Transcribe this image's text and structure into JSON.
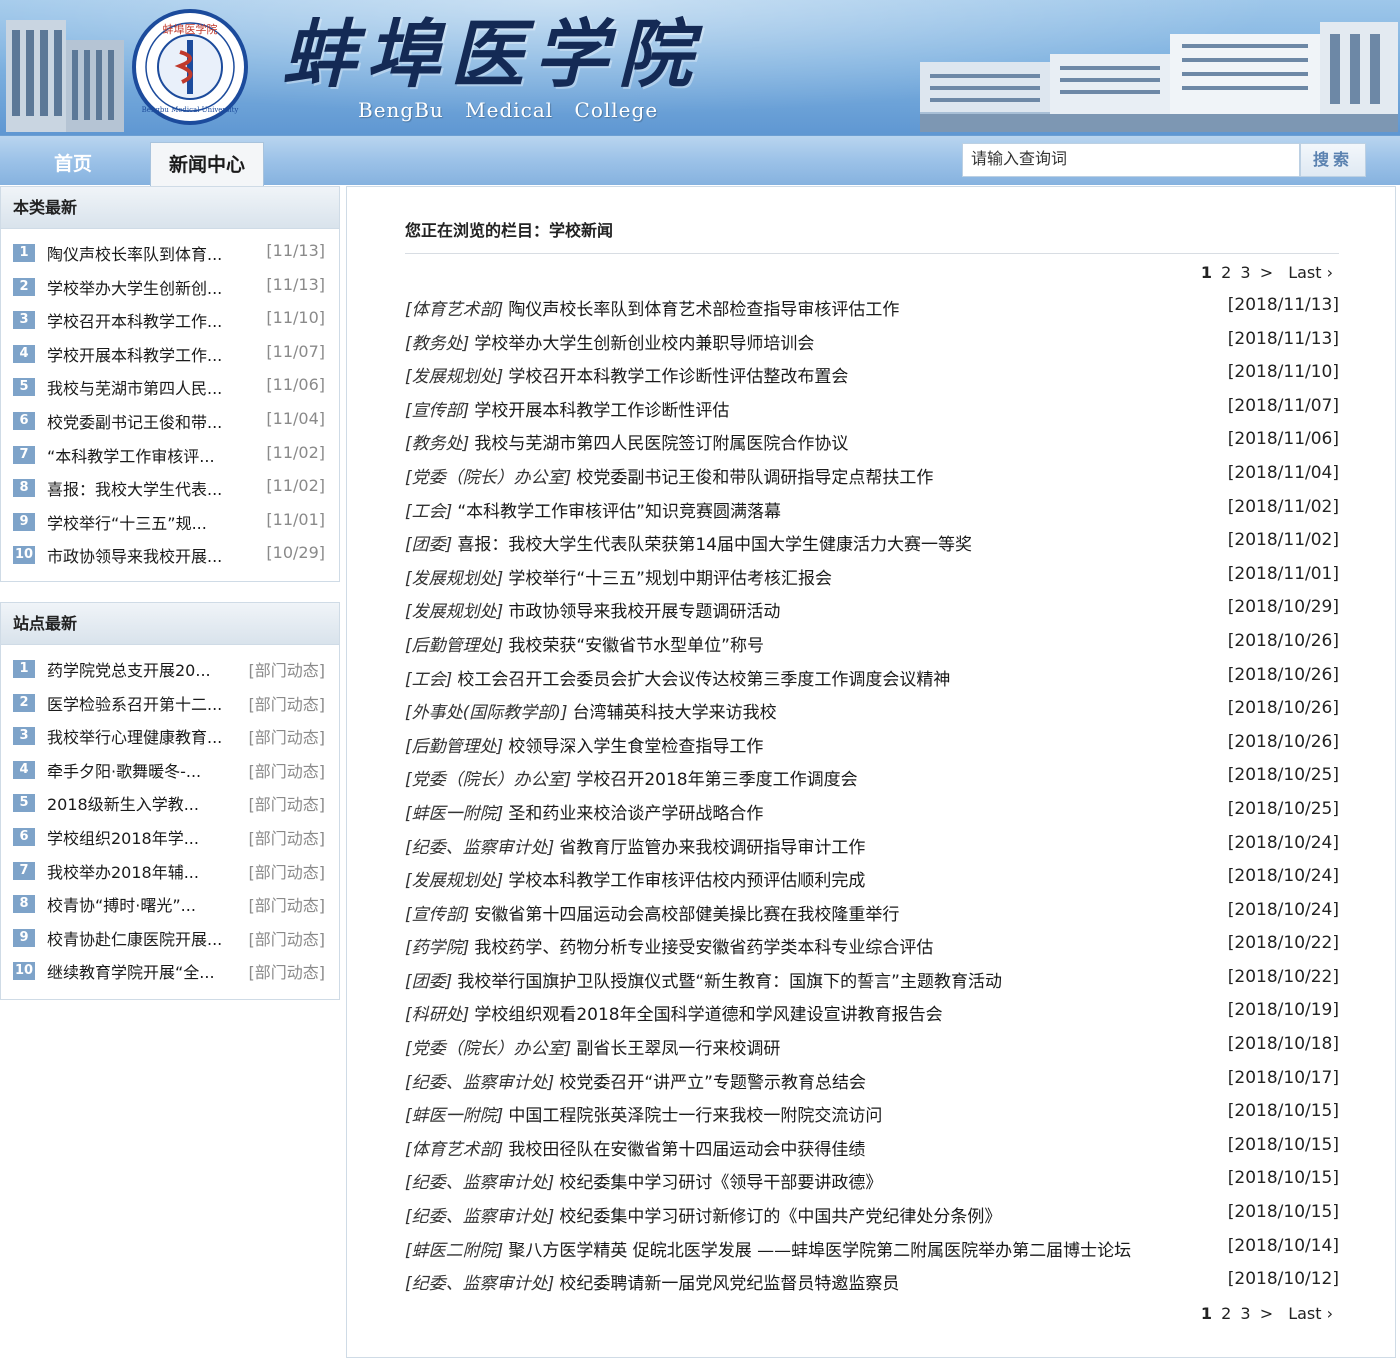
{
  "header": {
    "logo_cn": "蚌埠医学院",
    "logo_en": "BengBu Medical College",
    "emblem_text": "蚌埠医学院 Bengbu Medical University"
  },
  "nav": {
    "home": "首页",
    "news_center": "新闻中心",
    "search_placeholder": "请输入查询词",
    "search_button": "搜索"
  },
  "sidebar": {
    "recent_title": "本类最新",
    "recent": [
      {
        "num": "1",
        "title": "陶仪声校长率队到体育...",
        "date": "[11/13]"
      },
      {
        "num": "2",
        "title": "学校举办大学生创新创...",
        "date": "[11/13]"
      },
      {
        "num": "3",
        "title": "学校召开本科教学工作...",
        "date": "[11/10]"
      },
      {
        "num": "4",
        "title": "学校开展本科教学工作...",
        "date": "[11/07]"
      },
      {
        "num": "5",
        "title": "我校与芜湖市第四人民...",
        "date": "[11/06]"
      },
      {
        "num": "6",
        "title": "校党委副书记王俊和带...",
        "date": "[11/04]"
      },
      {
        "num": "7",
        "title": "“本科教学工作审核评...",
        "date": "[11/02]"
      },
      {
        "num": "8",
        "title": "喜报：我校大学生代表...",
        "date": "[11/02]"
      },
      {
        "num": "9",
        "title": "学校举行“十三五”规...",
        "date": "[11/01]"
      },
      {
        "num": "10",
        "title": "市政协领导来我校开展...",
        "date": "[10/29]"
      }
    ],
    "site_title": "站点最新",
    "site": [
      {
        "num": "1",
        "title": "药学院党总支开展20...",
        "date": "[部门动态]"
      },
      {
        "num": "2",
        "title": "医学检验系召开第十二...",
        "date": "[部门动态]"
      },
      {
        "num": "3",
        "title": "我校举行心理健康教育...",
        "date": "[部门动态]"
      },
      {
        "num": "4",
        "title": "牵手夕阳·歌舞暖冬-...",
        "date": "[部门动态]"
      },
      {
        "num": "5",
        "title": "2018级新生入学教...",
        "date": "[部门动态]"
      },
      {
        "num": "6",
        "title": "学校组织2018年学...",
        "date": "[部门动态]"
      },
      {
        "num": "7",
        "title": "我校举办2018年辅...",
        "date": "[部门动态]"
      },
      {
        "num": "8",
        "title": "校青协“搏时·曙光”...",
        "date": "[部门动态]"
      },
      {
        "num": "9",
        "title": "校青协赴仁康医院开展...",
        "date": "[部门动态]"
      },
      {
        "num": "10",
        "title": "继续教育学院开展“全...",
        "date": "[部门动态]"
      }
    ]
  },
  "main": {
    "breadcrumb": "您正在浏览的栏目：学校新闻",
    "pager": {
      "current": "1",
      "p2": "2",
      "p3": "3",
      "next": ">",
      "last": "Last ›"
    },
    "news": [
      {
        "cat": "[体育艺术部]",
        "title": "陶仪声校长率队到体育艺术部检查指导审核评估工作",
        "date": "[2018/11/13]"
      },
      {
        "cat": "[教务处]",
        "title": "学校举办大学生创新创业校内兼职导师培训会",
        "date": "[2018/11/13]"
      },
      {
        "cat": "[发展规划处]",
        "title": "学校召开本科教学工作诊断性评估整改布置会",
        "date": "[2018/11/10]"
      },
      {
        "cat": "[宣传部]",
        "title": "学校开展本科教学工作诊断性评估",
        "date": "[2018/11/07]"
      },
      {
        "cat": "[教务处]",
        "title": "我校与芜湖市第四人民医院签订附属医院合作协议",
        "date": "[2018/11/06]"
      },
      {
        "cat": "[党委（院长）办公室]",
        "title": "校党委副书记王俊和带队调研指导定点帮扶工作",
        "date": "[2018/11/04]"
      },
      {
        "cat": "[工会]",
        "title": "“本科教学工作审核评估”知识竞赛圆满落幕",
        "date": "[2018/11/02]"
      },
      {
        "cat": "[团委]",
        "title": "喜报：我校大学生代表队荣获第14届中国大学生健康活力大赛一等奖",
        "date": "[2018/11/02]"
      },
      {
        "cat": "[发展规划处]",
        "title": "学校举行“十三五”规划中期评估考核汇报会",
        "date": "[2018/11/01]"
      },
      {
        "cat": "[发展规划处]",
        "title": "市政协领导来我校开展专题调研活动",
        "date": "[2018/10/29]"
      },
      {
        "cat": "[后勤管理处]",
        "title": "我校荣获“安徽省节水型单位”称号",
        "date": "[2018/10/26]"
      },
      {
        "cat": "[工会]",
        "title": "校工会召开工会委员会扩大会议传达校第三季度工作调度会议精神",
        "date": "[2018/10/26]"
      },
      {
        "cat": "[外事处(国际教学部)]",
        "title": "台湾辅英科技大学来访我校",
        "date": "[2018/10/26]"
      },
      {
        "cat": "[后勤管理处]",
        "title": "校领导深入学生食堂检查指导工作",
        "date": "[2018/10/26]"
      },
      {
        "cat": "[党委（院长）办公室]",
        "title": "学校召开2018年第三季度工作调度会",
        "date": "[2018/10/25]"
      },
      {
        "cat": "[蚌医一附院]",
        "title": "圣和药业来校洽谈产学研战略合作",
        "date": "[2018/10/25]"
      },
      {
        "cat": "[纪委、监察审计处]",
        "title": "省教育厅监管办来我校调研指导审计工作",
        "date": "[2018/10/24]"
      },
      {
        "cat": "[发展规划处]",
        "title": "学校本科教学工作审核评估校内预评估顺利完成",
        "date": "[2018/10/24]"
      },
      {
        "cat": "[宣传部]",
        "title": "安徽省第十四届运动会高校部健美操比赛在我校隆重举行",
        "date": "[2018/10/24]"
      },
      {
        "cat": "[药学院]",
        "title": "我校药学、药物分析专业接受安徽省药学类本科专业综合评估",
        "date": "[2018/10/22]"
      },
      {
        "cat": "[团委]",
        "title": "我校举行国旗护卫队授旗仪式暨“新生教育：国旗下的誓言”主题教育活动",
        "date": "[2018/10/22]"
      },
      {
        "cat": "[科研处]",
        "title": "学校组织观看2018年全国科学道德和学风建设宣讲教育报告会",
        "date": "[2018/10/19]"
      },
      {
        "cat": "[党委（院长）办公室]",
        "title": "副省长王翠凤一行来校调研",
        "date": "[2018/10/18]"
      },
      {
        "cat": "[纪委、监察审计处]",
        "title": "校党委召开“讲严立”专题警示教育总结会",
        "date": "[2018/10/17]"
      },
      {
        "cat": "[蚌医一附院]",
        "title": "中国工程院张英泽院士一行来我校一附院交流访问",
        "date": "[2018/10/15]"
      },
      {
        "cat": "[体育艺术部]",
        "title": "我校田径队在安徽省第十四届运动会中获得佳绩",
        "date": "[2018/10/15]"
      },
      {
        "cat": "[纪委、监察审计处]",
        "title": "校纪委集中学习研讨《领导干部要讲政德》",
        "date": "[2018/10/15]"
      },
      {
        "cat": "[纪委、监察审计处]",
        "title": "校纪委集中学习研讨新修订的《中国共产党纪律处分条例》",
        "date": "[2018/10/15]"
      },
      {
        "cat": "[蚌医二附院]",
        "title": "聚八方医学精英 促皖北医学发展 ——蚌埠医学院第二附属医院举办第二届博士论坛",
        "date": "[2018/10/14]"
      },
      {
        "cat": "[纪委、监察审计处]",
        "title": "校纪委聘请新一届党风党纪监督员特邀监察员",
        "date": "[2018/10/12]"
      }
    ]
  }
}
